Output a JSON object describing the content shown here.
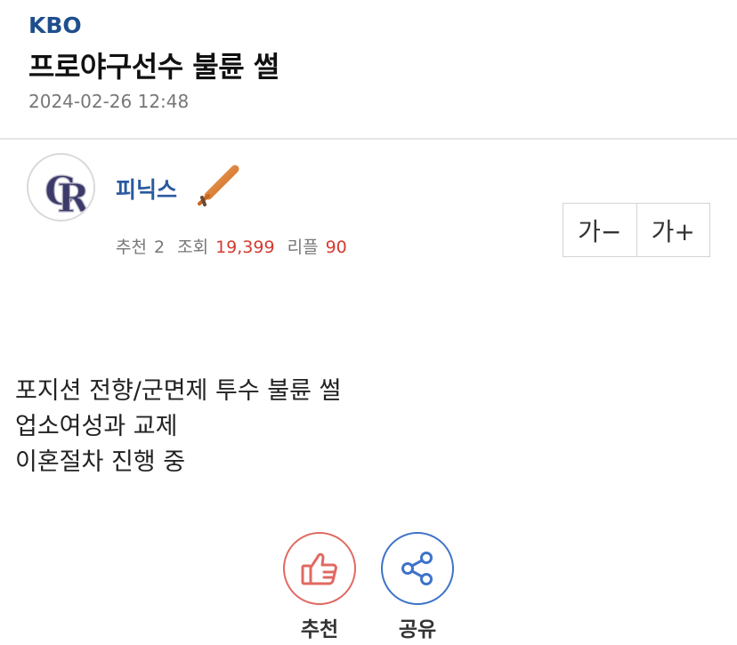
{
  "post": {
    "category": "KBO",
    "title": "프로야구선수 불륜 썰",
    "datetime": "2024-02-26 12:48"
  },
  "author": {
    "name": "피닉스",
    "avatar_icon": "rockies-cr-logo",
    "badge_icon": "baseball-bat-icon"
  },
  "stats": {
    "recommend_label": "추천",
    "recommend_count": "2",
    "views_label": "조회",
    "views_count": "19,399",
    "replies_label": "리플",
    "replies_count": "90"
  },
  "font_controls": {
    "decrease_label": "가−",
    "increase_label": "가+"
  },
  "content": {
    "lines": [
      "포지션 전향/군면제 투수 불륜 썰",
      "업소여성과 교제",
      "이혼절차 진행 중"
    ]
  },
  "actions": {
    "recommend_label": "추천",
    "share_label": "공유"
  },
  "colors": {
    "category": "#1f4e8c",
    "author": "#2a5aa0",
    "highlight_number": "#d43a2f",
    "recommend_ring": "#e06a62",
    "share_ring": "#3e73c8"
  }
}
